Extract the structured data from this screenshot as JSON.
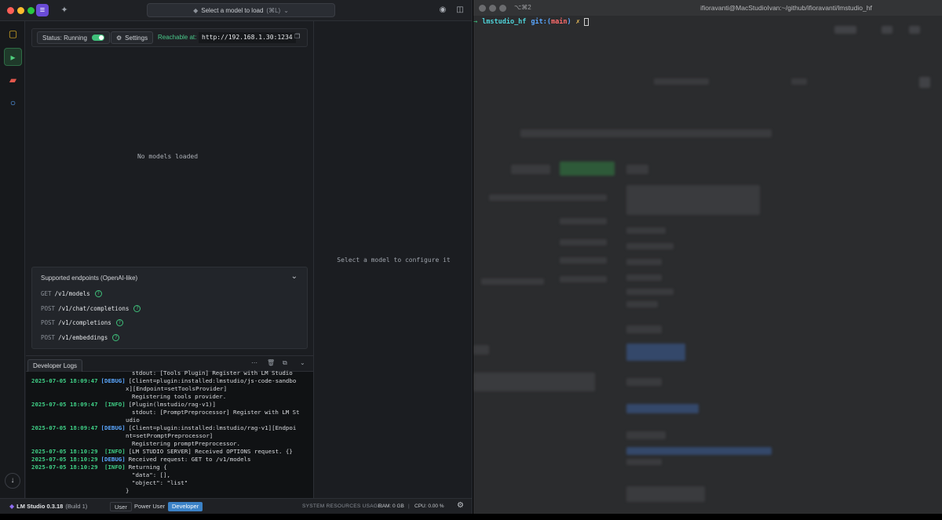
{
  "lmstudio": {
    "model_selector_label": "Select a model to load",
    "model_selector_shortcut": "(⌘L)",
    "server": {
      "status_label": "Status: Running",
      "status_on": true,
      "settings_label": "Settings",
      "reachable_label": "Reachable at:",
      "reachable_url": "http://192.168.1.30:1234"
    },
    "no_models_text": "No models loaded",
    "config_hint": "Select a model to configure it",
    "endpoints": {
      "title": "Supported endpoints (OpenAI-like)",
      "items": [
        {
          "method": "GET",
          "path": "/v1/models"
        },
        {
          "method": "POST",
          "path": "/v1/chat/completions"
        },
        {
          "method": "POST",
          "path": "/v1/completions"
        },
        {
          "method": "POST",
          "path": "/v1/embeddings"
        }
      ]
    },
    "logs": {
      "tab_label": "Developer Logs",
      "lines": [
        {
          "ts": "",
          "lvl": "",
          "msg": "stdout: [Tools Plugin] Register with LM Studio",
          "kind": "cont2"
        },
        {
          "ts": "2025-07-05 18:09:47",
          "lvl": "[DEBUG]",
          "msg": "[Client=plugin:installed:lmstudio/js-code-sandbo",
          "kind": "debug"
        },
        {
          "ts": "",
          "lvl": "",
          "msg": "x][Endpoint=setToolsProvider]",
          "kind": "cont"
        },
        {
          "ts": "",
          "lvl": "",
          "msg": "Registering tools provider.",
          "kind": "cont2"
        },
        {
          "ts": "2025-07-05 18:09:47",
          "lvl": " [INFO]",
          "msg": "[Plugin(lmstudio/rag-v1)]",
          "kind": "info"
        },
        {
          "ts": "",
          "lvl": "",
          "msg": "stdout: [PromptPreprocessor] Register with LM St",
          "kind": "cont2"
        },
        {
          "ts": "",
          "lvl": "",
          "msg": "udio",
          "kind": "cont"
        },
        {
          "ts": "2025-07-05 18:09:47",
          "lvl": "[DEBUG]",
          "msg": "[Client=plugin:installed:lmstudio/rag-v1][Endpoi",
          "kind": "debug"
        },
        {
          "ts": "",
          "lvl": "",
          "msg": "nt=setPromptPreprocessor]",
          "kind": "cont"
        },
        {
          "ts": "",
          "lvl": "",
          "msg": "Registering promptPreprocessor.",
          "kind": "cont2"
        },
        {
          "ts": "2025-07-05 18:10:29",
          "lvl": " [INFO]",
          "msg": "[LM STUDIO SERVER] Received OPTIONS request. {}",
          "kind": "info"
        },
        {
          "ts": "2025-07-05 18:10:29",
          "lvl": "[DEBUG]",
          "msg": "Received request: GET to /v1/models",
          "kind": "debug"
        },
        {
          "ts": "2025-07-05 18:10:29",
          "lvl": " [INFO]",
          "msg": "Returning {",
          "kind": "info"
        },
        {
          "ts": "",
          "lvl": "",
          "msg": "  \"data\": [],",
          "kind": "cont2"
        },
        {
          "ts": "",
          "lvl": "",
          "msg": "  \"object\": \"list\"",
          "kind": "cont2"
        },
        {
          "ts": "",
          "lvl": "",
          "msg": "}",
          "kind": "cont"
        }
      ]
    },
    "statusbar": {
      "app_name": "LM Studio 0.3.18",
      "build": "(Build 1)",
      "modes": [
        "User",
        "Power User",
        "Developer"
      ],
      "active_mode": "Developer",
      "sys_label": "SYSTEM RESOURCES USAGE:",
      "ram": "RAM: 0 GB",
      "separator": "|",
      "cpu": "CPU: 0.00 %"
    }
  },
  "terminal": {
    "shortcut": "⌥⌘2",
    "title": "ifioravanti@MacStudioIvan:~/github/ifioravanti/lmstudio_hf",
    "prompt_arrow": "→",
    "prompt_dir": "lmstudio_hf",
    "prompt_git": "git:(",
    "prompt_branch": "main",
    "prompt_git_close": ")",
    "prompt_x": "✗"
  },
  "colors": {
    "accent_green": "#3fcf86",
    "debug_blue": "#5aa7ff",
    "developer_mode": "#3b82c7"
  }
}
